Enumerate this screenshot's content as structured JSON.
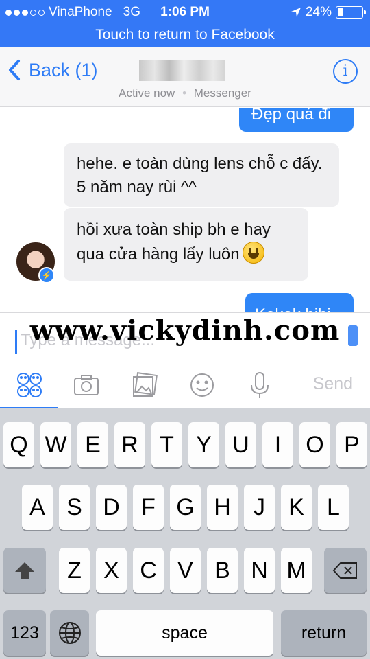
{
  "status_bar": {
    "carrier": "VinaPhone",
    "network": "3G",
    "time": "1:06 PM",
    "battery": "24%",
    "battery_level": 0.24,
    "signal_bars": 3,
    "icons": [
      "signal-dots-icon",
      "location-arrow-icon",
      "battery-icon"
    ]
  },
  "return_banner": "Touch to return to Facebook",
  "header": {
    "back_label": "Back (1)",
    "subtitle_active": "Active now",
    "subtitle_app": "Messenger",
    "icons": [
      "chevron-left-icon",
      "info-icon"
    ]
  },
  "messages": [
    {
      "side": "outgoing",
      "text": "Đẹp quá đi"
    },
    {
      "side": "incoming",
      "text": "hehe. e toàn dùng lens chỗ c đấy. 5 năm nay rùi ^^"
    },
    {
      "side": "incoming",
      "text": "hồi xưa toàn ship bh e hay qua cửa hàng lấy luôn",
      "emoji": "smiley-emoji-icon"
    },
    {
      "side": "outgoing",
      "text": "Kekek hihi"
    }
  ],
  "composer": {
    "placeholder": "Type a message...",
    "send_label": "Send",
    "watermark": "www.vickydinh.com",
    "tools": [
      "stickers-icon",
      "camera-icon",
      "photos-icon",
      "emoji-icon",
      "microphone-icon"
    ]
  },
  "keyboard": {
    "row1": [
      "Q",
      "W",
      "E",
      "R",
      "T",
      "Y",
      "U",
      "I",
      "O",
      "P"
    ],
    "row2": [
      "A",
      "S",
      "D",
      "F",
      "G",
      "H",
      "J",
      "K",
      "L"
    ],
    "row3": [
      "Z",
      "X",
      "C",
      "V",
      "B",
      "N",
      "M"
    ],
    "numbers_key": "123",
    "space_key": "space",
    "return_key": "return",
    "icons": [
      "shift-icon",
      "delete-icon",
      "globe-icon"
    ]
  },
  "colors": {
    "accent": "#2e7cf6",
    "status_bar": "#3478f6",
    "outgoing_bubble": "#2f86f7",
    "incoming_bubble": "#efeff1",
    "keyboard_bg": "#d1d4d9"
  }
}
